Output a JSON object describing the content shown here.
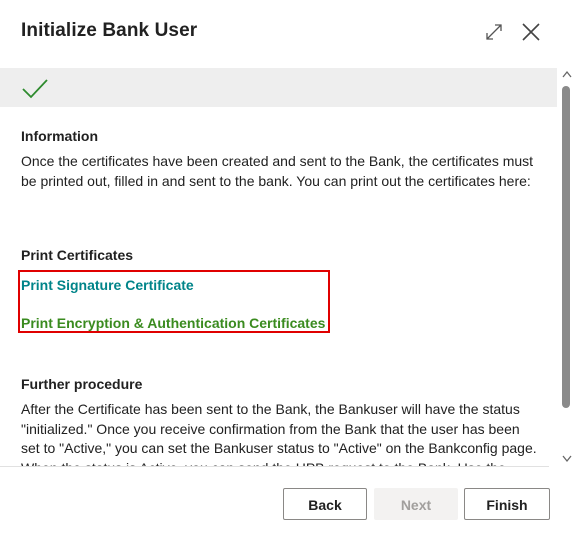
{
  "dialog": {
    "title": "Initialize Bank User",
    "expand_icon": "expand-icon",
    "close_icon": "close-icon"
  },
  "status": {
    "icon": "checkmark-icon",
    "color": "#2e8b2e"
  },
  "information": {
    "heading": "Information",
    "text": "Once the certificates have been created and sent to the Bank, the certificates must be printed out, filled in and sent to the bank. You can print out the certificates here:"
  },
  "print_certificates": {
    "heading": "Print Certificates",
    "signature_link": "Print Signature Certificate",
    "encryption_link": "Print Encryption & Authentication Certificates",
    "signature_color": "#008489",
    "encryption_color": "#3a8b1f",
    "highlight_color": "#e00000"
  },
  "further_procedure": {
    "heading": "Further procedure",
    "text": "After the Certificate has been sent to the Bank, the Bankuser will have the status \"initialized.\" Once you receive confirmation from the Bank that the user has been set to \"Active,\" you can set the Bankuser status to \"Active\" on the Bankconfig page. When the status is Active, you can send the HPB request to the Bank. Use the"
  },
  "buttons": {
    "back": "Back",
    "next": "Next",
    "finish": "Finish"
  }
}
